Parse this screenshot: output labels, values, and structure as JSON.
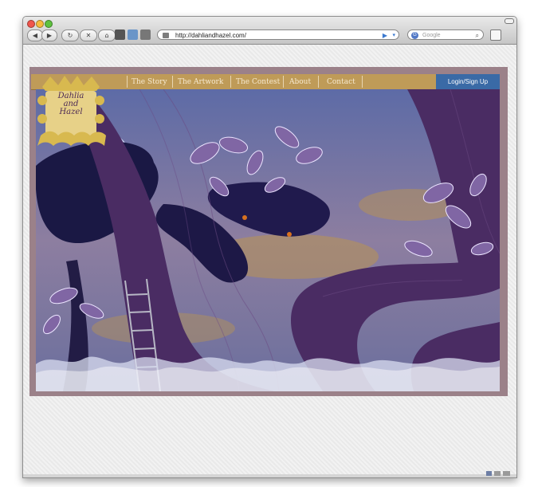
{
  "browser": {
    "address": "http://dahliandhazel.com/",
    "search_placeholder": "Google"
  },
  "site": {
    "logo_text": "Dahlia and Hazel",
    "nav": [
      "The Story",
      "The Artwork",
      "The Contest",
      "About",
      "Contact"
    ],
    "login_label": "Login/Sign Up"
  },
  "colors": {
    "nav_bg": "#bf9b58",
    "login_bg": "#3a6aa6",
    "tree_purple": "#4a2c63",
    "sky_blue": "#5f69a1"
  }
}
